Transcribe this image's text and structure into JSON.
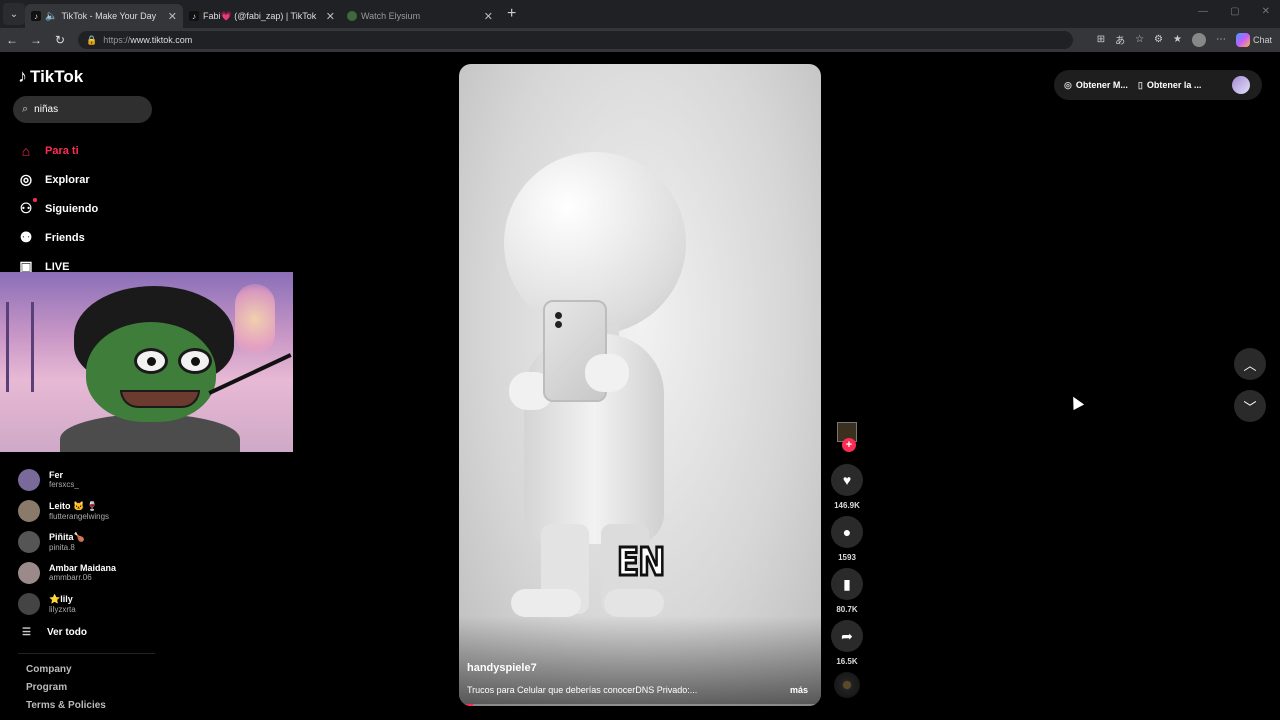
{
  "browser": {
    "tabs": [
      {
        "title": "TikTok - Make Your Day",
        "active": true,
        "audio": true
      },
      {
        "title": "Fabi💗 (@fabi_zap) | TikTok",
        "active": false
      },
      {
        "title": "Watch Elysium",
        "active": false
      }
    ],
    "url_scheme": "https://",
    "url_host": "www.tiktok.com",
    "copilot_label": "Chat"
  },
  "sidebar": {
    "brand": "TikTok",
    "search_value": "niñas",
    "nav": [
      {
        "label": "Para ti",
        "icon": "home-icon",
        "active": true
      },
      {
        "label": "Explorar",
        "icon": "compass-icon"
      },
      {
        "label": "Siguiendo",
        "icon": "following-icon"
      },
      {
        "label": "Friends",
        "icon": "friends-icon"
      },
      {
        "label": "LIVE",
        "icon": "live-icon"
      }
    ],
    "following": [
      {
        "name": "Fer",
        "handle": "fersxcs_"
      },
      {
        "name": "Leito 🐱 🍷",
        "handle": "flutterangelwings"
      },
      {
        "name": "Piñita🍗",
        "handle": "pinita.8"
      },
      {
        "name": "Ambar Maidana",
        "handle": "ammbarr.06"
      },
      {
        "name": "⭐lily",
        "handle": "lilyzxrta"
      }
    ],
    "see_all": "Ver todo",
    "footer": [
      "Company",
      "Program",
      "Terms & Policies"
    ]
  },
  "video": {
    "author": "handyspiele7",
    "description": "Trucos para Celular que deberías conocerDNS Privado:...",
    "more": "más",
    "caption_overlay": "EN",
    "progress": 0.04,
    "likes": "146.9K",
    "comments": "1593",
    "saves": "80.7K",
    "shares": "16.5K"
  },
  "top_actions": {
    "get_coins": "Obtener M...",
    "get_app": "Obtener la ..."
  },
  "colors": {
    "accent": "#fe2c55",
    "background": "#000000"
  }
}
